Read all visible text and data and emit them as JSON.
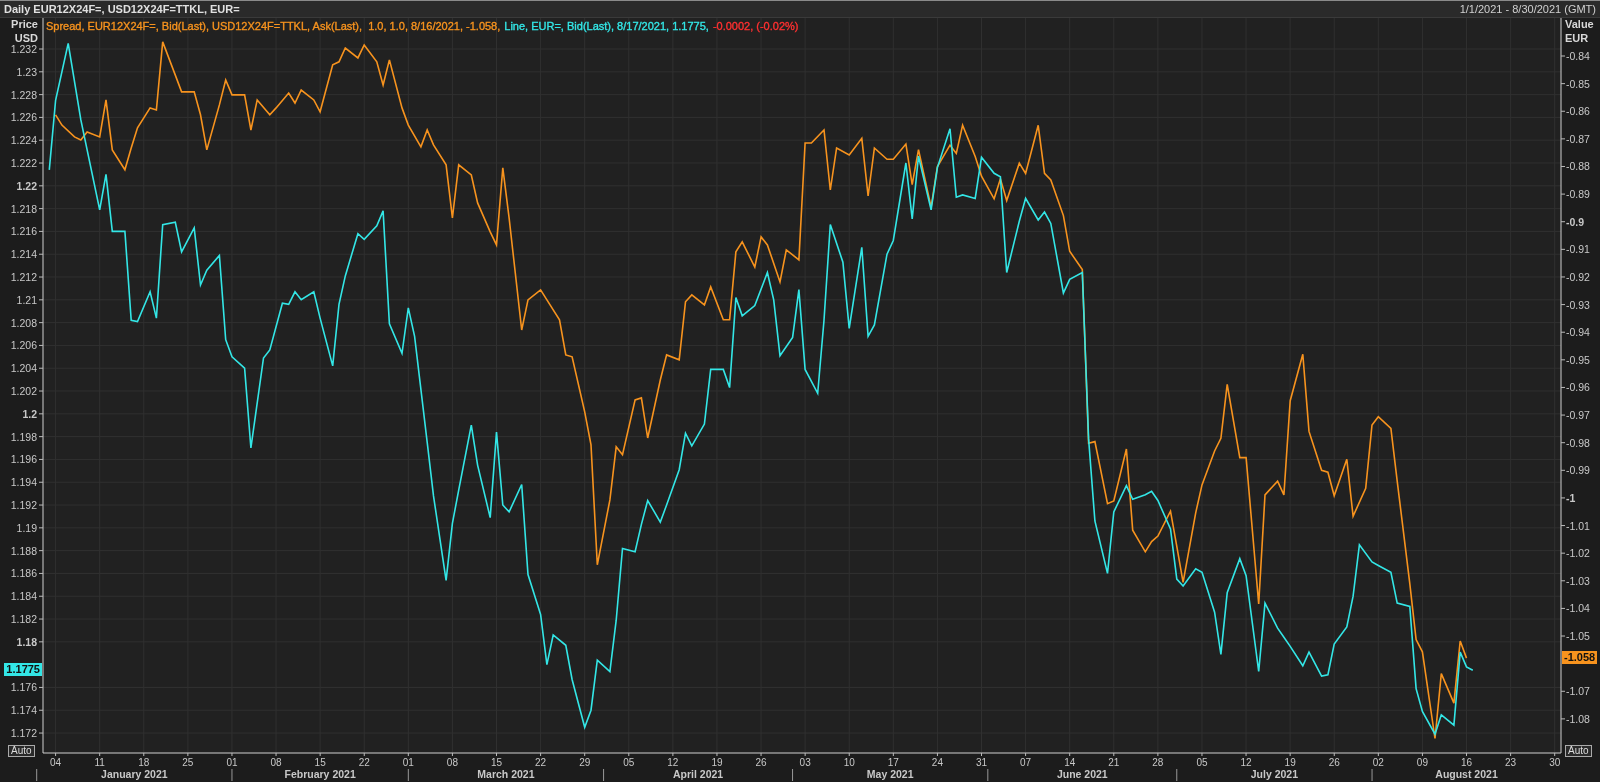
{
  "title_bar": {
    "title": "Daily EUR12X24F=, USD12X24F=TTKL, EUR=",
    "date_range": "1/1/2021 - 8/30/2021 (GMT)"
  },
  "legend": [
    {
      "text": "Spread, EUR12X24F=, Bid(Last), USD12X24F=TTKL, Ask(Last),  1.0, 1.0, 8/16/2021, -1.058,",
      "color": "#f7931e"
    },
    {
      "text": "Line, EUR=, Bid(Last), 8/17/2021, 1.1775,",
      "color": "#33e6e6"
    },
    {
      "text": "-0.0002, (-0.02%)",
      "color": "#ff3030"
    }
  ],
  "scale_buttons": [
    "Auto",
    "Auto"
  ],
  "value_badges": [
    "-1.058",
    "1.1775"
  ],
  "month_labels": [
    "January 2021",
    "February 2021",
    "March 2021",
    "April 2021",
    "May 2021",
    "June 2021",
    "July 2021",
    "August 2021"
  ],
  "chart_data": {
    "type": "line",
    "grid": true,
    "ylabel": "Price USD",
    "y2label": "Value EUR",
    "xlim": [
      "2021-01-02",
      "2021-08-31"
    ],
    "ylim": [
      1.17025,
      1.23472
    ],
    "y2lim": [
      -1.09235,
      -0.82624
    ],
    "xticks": [
      {
        "value": "2021-01-04",
        "label": "04"
      },
      {
        "value": "2021-01-11",
        "label": "11"
      },
      {
        "value": "2021-01-18",
        "label": "18"
      },
      {
        "value": "2021-01-25",
        "label": "25"
      },
      {
        "value": "2021-02-01",
        "label": "01"
      },
      {
        "value": "2021-02-08",
        "label": "08"
      },
      {
        "value": "2021-02-15",
        "label": "15"
      },
      {
        "value": "2021-02-22",
        "label": "22"
      },
      {
        "value": "2021-03-01",
        "label": "01"
      },
      {
        "value": "2021-03-08",
        "label": "08"
      },
      {
        "value": "2021-03-15",
        "label": "15"
      },
      {
        "value": "2021-03-22",
        "label": "22"
      },
      {
        "value": "2021-03-29",
        "label": "29"
      },
      {
        "value": "2021-04-05",
        "label": "05"
      },
      {
        "value": "2021-04-12",
        "label": "12"
      },
      {
        "value": "2021-04-19",
        "label": "19"
      },
      {
        "value": "2021-04-26",
        "label": "26"
      },
      {
        "value": "2021-05-03",
        "label": "03"
      },
      {
        "value": "2021-05-10",
        "label": "10"
      },
      {
        "value": "2021-05-17",
        "label": "17"
      },
      {
        "value": "2021-05-24",
        "label": "24"
      },
      {
        "value": "2021-05-31",
        "label": "31"
      },
      {
        "value": "2021-06-07",
        "label": "07"
      },
      {
        "value": "2021-06-14",
        "label": "14"
      },
      {
        "value": "2021-06-21",
        "label": "21"
      },
      {
        "value": "2021-06-28",
        "label": "28"
      },
      {
        "value": "2021-07-05",
        "label": "05"
      },
      {
        "value": "2021-07-12",
        "label": "12"
      },
      {
        "value": "2021-07-19",
        "label": "19"
      },
      {
        "value": "2021-07-26",
        "label": "26"
      },
      {
        "value": "2021-08-02",
        "label": "02"
      },
      {
        "value": "2021-08-09",
        "label": "09"
      },
      {
        "value": "2021-08-16",
        "label": "16"
      },
      {
        "value": "2021-08-23",
        "label": "23"
      },
      {
        "value": "2021-08-30",
        "label": "30"
      }
    ],
    "yticks": [
      1.172,
      1.174,
      1.176,
      1.18,
      1.182,
      1.184,
      1.186,
      1.188,
      1.19,
      1.192,
      1.194,
      1.196,
      1.198,
      1.2,
      1.202,
      1.204,
      1.206,
      1.208,
      1.21,
      1.212,
      1.214,
      1.216,
      1.218,
      1.22,
      1.222,
      1.224,
      1.226,
      1.228,
      1.23,
      1.232
    ],
    "y2ticks": [
      -1.08,
      -1.07,
      -1.05,
      -1.04,
      -1.03,
      -1.02,
      -1.01,
      -1,
      -0.99,
      -0.98,
      -0.97,
      -0.96,
      -0.95,
      -0.94,
      -0.93,
      -0.92,
      -0.91,
      -0.9,
      -0.89,
      -0.88,
      -0.87,
      -0.86,
      -0.85,
      -0.84
    ],
    "series": [
      {
        "color": "#f7931e",
        "axis": "y2",
        "x": [
          "2021-01-04",
          "2021-01-05",
          "2021-01-07",
          "2021-01-08",
          "2021-01-09",
          "2021-01-11",
          "2021-01-12",
          "2021-01-13",
          "2021-01-15",
          "2021-01-16",
          "2021-01-17",
          "2021-01-19",
          "2021-01-20",
          "2021-01-21",
          "2021-01-23",
          "2021-01-24",
          "2021-01-26",
          "2021-01-27",
          "2021-01-28",
          "2021-01-30",
          "2021-01-31",
          "2021-02-01",
          "2021-02-03",
          "2021-02-04",
          "2021-02-05",
          "2021-02-07",
          "2021-02-08",
          "2021-02-10",
          "2021-02-11",
          "2021-02-12",
          "2021-02-14",
          "2021-02-15",
          "2021-02-17",
          "2021-02-18",
          "2021-02-19",
          "2021-02-21",
          "2021-02-22",
          "2021-02-24",
          "2021-02-25",
          "2021-02-26",
          "2021-02-28",
          "2021-03-01",
          "2021-03-03",
          "2021-03-04",
          "2021-03-05",
          "2021-03-07",
          "2021-03-08",
          "2021-03-09",
          "2021-03-11",
          "2021-03-12",
          "2021-03-14",
          "2021-03-15",
          "2021-03-16",
          "2021-03-17",
          "2021-03-19",
          "2021-03-20",
          "2021-03-22",
          "2021-03-23",
          "2021-03-25",
          "2021-03-26",
          "2021-03-27",
          "2021-03-29",
          "2021-03-30",
          "2021-03-31",
          "2021-04-02",
          "2021-04-03",
          "2021-04-04",
          "2021-04-06",
          "2021-04-07",
          "2021-04-08",
          "2021-04-10",
          "2021-04-11",
          "2021-04-13",
          "2021-04-14",
          "2021-04-15",
          "2021-04-17",
          "2021-04-18",
          "2021-04-20",
          "2021-04-21",
          "2021-04-22",
          "2021-04-23",
          "2021-04-25",
          "2021-04-26",
          "2021-04-27",
          "2021-04-29",
          "2021-04-30",
          "2021-05-02",
          "2021-05-03",
          "2021-05-04",
          "2021-05-06",
          "2021-05-07",
          "2021-05-08",
          "2021-05-10",
          "2021-05-12",
          "2021-05-13",
          "2021-05-14",
          "2021-05-16",
          "2021-05-17",
          "2021-05-19",
          "2021-05-20",
          "2021-05-21",
          "2021-05-23",
          "2021-05-24",
          "2021-05-26",
          "2021-05-27",
          "2021-05-28",
          "2021-05-30",
          "2021-05-31",
          "2021-06-02",
          "2021-06-03",
          "2021-06-04",
          "2021-06-06",
          "2021-06-07",
          "2021-06-09",
          "2021-06-10",
          "2021-06-11",
          "2021-06-13",
          "2021-06-14",
          "2021-06-16",
          "2021-06-17",
          "2021-06-18",
          "2021-06-20",
          "2021-06-21",
          "2021-06-23",
          "2021-06-24",
          "2021-06-26",
          "2021-06-27",
          "2021-06-28",
          "2021-06-30",
          "2021-07-01",
          "2021-07-02",
          "2021-07-04",
          "2021-07-05",
          "2021-07-07",
          "2021-07-08",
          "2021-07-09",
          "2021-07-11",
          "2021-07-12",
          "2021-07-14",
          "2021-07-15",
          "2021-07-17",
          "2021-07-18",
          "2021-07-19",
          "2021-07-21",
          "2021-07-22",
          "2021-07-24",
          "2021-07-25",
          "2021-07-26",
          "2021-07-28",
          "2021-07-29",
          "2021-07-31",
          "2021-08-01",
          "2021-08-02",
          "2021-08-04",
          "2021-08-05",
          "2021-08-07",
          "2021-08-08",
          "2021-08-09",
          "2021-08-11",
          "2021-08-12",
          "2021-08-14",
          "2021-08-15",
          "2021-08-16"
        ],
        "values": [
          -0.8613,
          -0.865,
          -0.8693,
          -0.8704,
          -0.8675,
          -0.8693,
          -0.8559,
          -0.874,
          -0.8812,
          -0.8733,
          -0.866,
          -0.8588,
          -0.8595,
          -0.8349,
          -0.8469,
          -0.853,
          -0.853,
          -0.8613,
          -0.874,
          -0.8577,
          -0.8487,
          -0.8541,
          -0.8541,
          -0.8668,
          -0.8559,
          -0.8613,
          -0.8588,
          -0.8534,
          -0.857,
          -0.8523,
          -0.8559,
          -0.8602,
          -0.8432,
          -0.8421,
          -0.8371,
          -0.8407,
          -0.836,
          -0.8421,
          -0.8505,
          -0.8414,
          -0.8588,
          -0.865,
          -0.8729,
          -0.8668,
          -0.8722,
          -0.8794,
          -0.8986,
          -0.8794,
          -0.8831,
          -0.8932,
          -0.9037,
          -0.9084,
          -0.8805,
          -0.8986,
          -0.9392,
          -0.9283,
          -0.9247,
          -0.9283,
          -0.9355,
          -0.9482,
          -0.9489,
          -0.9688,
          -0.9808,
          -1.0242,
          -1.0007,
          -0.9815,
          -0.9844,
          -0.9645,
          -0.9638,
          -0.9783,
          -0.9573,
          -0.9482,
          -0.95,
          -0.929,
          -0.9265,
          -0.9301,
          -0.9236,
          -0.9355,
          -0.9355,
          -0.9109,
          -0.9073,
          -0.9164,
          -0.9055,
          -0.9084,
          -0.9218,
          -0.9102,
          -0.9138,
          -0.8715,
          -0.8715,
          -0.8668,
          -0.8885,
          -0.8733,
          -0.8758,
          -0.8698,
          -0.8907,
          -0.8733,
          -0.8774,
          -0.8774,
          -0.8719,
          -0.8866,
          -0.8739,
          -0.8947,
          -0.88,
          -0.8723,
          -0.8753,
          -0.8651,
          -0.8764,
          -0.8835,
          -0.8917,
          -0.8845,
          -0.8923,
          -0.8788,
          -0.8825,
          -0.8651,
          -0.8825,
          -0.8849,
          -0.8978,
          -0.9107,
          -0.9173,
          -0.9802,
          -0.9796,
          -1.0021,
          -1.0011,
          -0.9823,
          -1.0117,
          -1.0195,
          -1.0158,
          -1.0138,
          -1.0048,
          -1.0175,
          -1.0306,
          -1.0054,
          -0.9953,
          -0.983,
          -0.9784,
          -0.9589,
          -0.9854,
          -0.9854,
          -1.0384,
          -0.9989,
          -0.9939,
          -0.9989,
          -0.9648,
          -0.948,
          -0.9759,
          -0.99,
          -0.9907,
          -0.9992,
          -0.986,
          -1.0066,
          -0.9965,
          -0.9736,
          -0.9706,
          -0.9748,
          -0.9939,
          -1.031,
          -1.0513,
          -1.0557,
          -1.0871,
          -1.0636,
          -1.0743,
          -1.0518,
          -1.058
        ]
      },
      {
        "color": "#33e6e6",
        "x": [
          "2021-01-03",
          "2021-01-04",
          "2021-01-06",
          "2021-01-08",
          "2021-01-11",
          "2021-01-12",
          "2021-01-13",
          "2021-01-15",
          "2021-01-16",
          "2021-01-17",
          "2021-01-19",
          "2021-01-20",
          "2021-01-21",
          "2021-01-23",
          "2021-01-24",
          "2021-01-26",
          "2021-01-27",
          "2021-01-28",
          "2021-01-30",
          "2021-01-31",
          "2021-02-01",
          "2021-02-03",
          "2021-02-04",
          "2021-02-06",
          "2021-02-07",
          "2021-02-09",
          "2021-02-10",
          "2021-02-11",
          "2021-02-12",
          "2021-02-14",
          "2021-02-15",
          "2021-02-17",
          "2021-02-18",
          "2021-02-19",
          "2021-02-21",
          "2021-02-22",
          "2021-02-24",
          "2021-02-25",
          "2021-02-26",
          "2021-02-28",
          "2021-03-01",
          "2021-03-02",
          "2021-03-04",
          "2021-03-05",
          "2021-03-07",
          "2021-03-08",
          "2021-03-09",
          "2021-03-11",
          "2021-03-12",
          "2021-03-14",
          "2021-03-15",
          "2021-03-16",
          "2021-03-17",
          "2021-03-19",
          "2021-03-20",
          "2021-03-22",
          "2021-03-23",
          "2021-03-24",
          "2021-03-26",
          "2021-03-27",
          "2021-03-29",
          "2021-03-30",
          "2021-03-31",
          "2021-04-02",
          "2021-04-03",
          "2021-04-04",
          "2021-04-06",
          "2021-04-07",
          "2021-04-08",
          "2021-04-10",
          "2021-04-11",
          "2021-04-13",
          "2021-04-14",
          "2021-04-15",
          "2021-04-17",
          "2021-04-18",
          "2021-04-20",
          "2021-04-21",
          "2021-04-22",
          "2021-04-23",
          "2021-04-25",
          "2021-04-27",
          "2021-04-28",
          "2021-04-29",
          "2021-05-01",
          "2021-05-02",
          "2021-05-03",
          "2021-05-05",
          "2021-05-06",
          "2021-05-07",
          "2021-05-09",
          "2021-05-10",
          "2021-05-12",
          "2021-05-13",
          "2021-05-14",
          "2021-05-16",
          "2021-05-17",
          "2021-05-19",
          "2021-05-20",
          "2021-05-21",
          "2021-05-23",
          "2021-05-24",
          "2021-05-26",
          "2021-05-27",
          "2021-05-28",
          "2021-05-30",
          "2021-05-31",
          "2021-06-02",
          "2021-06-03",
          "2021-06-04",
          "2021-06-06",
          "2021-06-07",
          "2021-06-09",
          "2021-06-10",
          "2021-06-11",
          "2021-06-13",
          "2021-06-14",
          "2021-06-16",
          "2021-06-17",
          "2021-06-18",
          "2021-06-20",
          "2021-06-21",
          "2021-06-23",
          "2021-06-24",
          "2021-06-26",
          "2021-06-27",
          "2021-06-28",
          "2021-06-30",
          "2021-07-01",
          "2021-07-02",
          "2021-07-04",
          "2021-07-05",
          "2021-07-07",
          "2021-07-08",
          "2021-07-09",
          "2021-07-11",
          "2021-07-12",
          "2021-07-14",
          "2021-07-15",
          "2021-07-17",
          "2021-07-18",
          "2021-07-19",
          "2021-07-21",
          "2021-07-22",
          "2021-07-24",
          "2021-07-25",
          "2021-07-26",
          "2021-07-28",
          "2021-07-29",
          "2021-07-30",
          "2021-08-01",
          "2021-08-02",
          "2021-08-04",
          "2021-08-05",
          "2021-08-07",
          "2021-08-08",
          "2021-08-09",
          "2021-08-11",
          "2021-08-12",
          "2021-08-14",
          "2021-08-15",
          "2021-08-16",
          "2021-08-17"
        ],
        "values": [
          1.2214,
          1.2275,
          1.2325,
          1.2258,
          1.2179,
          1.221,
          1.216,
          1.216,
          1.2082,
          1.2081,
          1.2107,
          1.2084,
          1.2166,
          1.2168,
          1.2142,
          1.2163,
          1.2113,
          1.2126,
          1.2139,
          1.2065,
          1.205,
          1.204,
          1.197,
          1.2049,
          1.2056,
          1.2097,
          1.2096,
          1.2107,
          1.21,
          1.2107,
          1.2084,
          1.2042,
          1.2096,
          1.2121,
          1.2158,
          1.2153,
          1.2165,
          1.2178,
          1.2079,
          1.2053,
          1.2093,
          1.2068,
          1.1975,
          1.1928,
          1.1854,
          1.1904,
          1.1933,
          1.199,
          1.1955,
          1.1909,
          1.1984,
          1.192,
          1.1914,
          1.1938,
          1.1859,
          1.1824,
          1.178,
          1.1806,
          1.1797,
          1.1767,
          1.1725,
          1.174,
          1.1784,
          1.1774,
          1.1819,
          1.1882,
          1.1879,
          1.1903,
          1.1924,
          1.1905,
          1.192,
          1.1951,
          1.1983,
          1.1972,
          1.1991,
          1.2039,
          1.2039,
          1.2023,
          1.2102,
          1.2086,
          1.2095,
          1.2124,
          1.21,
          1.2051,
          1.2067,
          1.2109,
          1.2039,
          1.2018,
          1.2082,
          1.2166,
          1.2133,
          1.2075,
          1.2146,
          1.2068,
          1.2078,
          1.214,
          1.2152,
          1.222,
          1.2171,
          1.2226,
          1.2179,
          1.2216,
          1.225,
          1.219,
          1.2192,
          1.2189,
          1.2225,
          1.2211,
          1.2208,
          1.2124,
          1.2169,
          1.2189,
          1.217,
          1.2177,
          1.2167,
          1.2106,
          1.2118,
          1.2124,
          1.1978,
          1.1906,
          1.186,
          1.1914,
          1.1937,
          1.1925,
          1.1929,
          1.1932,
          1.1924,
          1.1899,
          1.1855,
          1.1849,
          1.1864,
          1.1861,
          1.1826,
          1.1789,
          1.1843,
          1.1873,
          1.1858,
          1.1774,
          1.1834,
          1.1812,
          1.1804,
          1.1796,
          1.1779,
          1.1791,
          1.177,
          1.1771,
          1.1798,
          1.1813,
          1.184,
          1.1885,
          1.187,
          1.1867,
          1.1861,
          1.1834,
          1.1831,
          1.1759,
          1.1739,
          1.1719,
          1.1736,
          1.1727,
          1.1791,
          1.1778,
          1.1775
        ]
      }
    ]
  }
}
